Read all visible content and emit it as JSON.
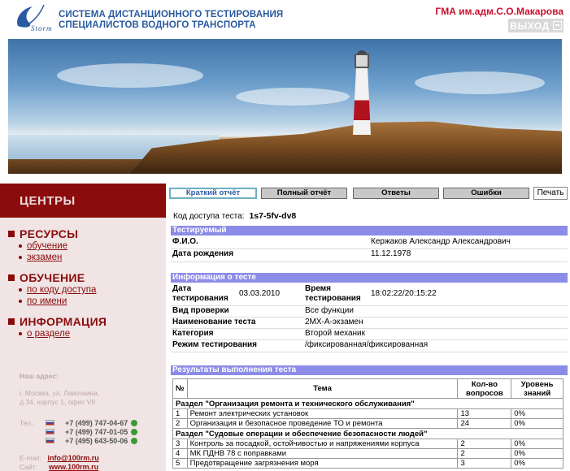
{
  "header": {
    "logo_text": "Storm",
    "title_line1": "СИСТЕМА ДИСТАНЦИОННОГО ТЕСТИРОВАНИЯ",
    "title_line2": "СПЕЦИАЛИСТОВ ВОДНОГО ТРАНСПОРТА",
    "org_name": "ГМА им.адм.С.О.Макарова",
    "logout_label": "ВЫХОД"
  },
  "sidebar": {
    "heading": "ЦЕНТРЫ",
    "sections": [
      {
        "title": "РЕСУРСЫ",
        "links": [
          "обучение",
          "экзамен"
        ]
      },
      {
        "title": "ОБУЧЕНИЕ",
        "links": [
          "по коду доступа",
          "по имени"
        ]
      },
      {
        "title": "ИНФОРМАЦИЯ",
        "links": [
          "о разделе"
        ]
      }
    ],
    "address_label": "Наш адрес:",
    "address_line1": "г. Москва, ул. Лавочкина,",
    "address_line2": "д.34, корпус 1, офис VII",
    "phone_label": "Тел.:",
    "phones": [
      "+7 (499) 747-04-67",
      "+7 (499) 747-01-05",
      "+7 (495) 643-50-06"
    ],
    "email_label": "E-mail:",
    "email": "info@100rm.ru",
    "site_label": "Сайт:",
    "site": "www.100rm.ru"
  },
  "tabs": {
    "short_report": "Краткий отчёт",
    "full_report": "Полный отчёт",
    "answers": "Ответы",
    "errors": "Ошибки",
    "print": "Печать"
  },
  "access": {
    "label": "Код доступа теста:",
    "code": "1s7-5fv-dv8"
  },
  "tested": {
    "heading": "Тестируемый",
    "fio_label": "Ф.И.О.",
    "fio": "Кержаков Александр Александрович",
    "dob_label": "Дата рождения",
    "dob": "11.12.1978"
  },
  "test_info": {
    "heading": "Информация о тесте",
    "date_label": "Дата тестирования",
    "date": "03.03.2010",
    "time_label": "Время тестирования",
    "time": "18:02:22/20:15:22",
    "check_label": "Вид проверки",
    "check": "Все функции",
    "name_label": "Наименование теста",
    "name": "2МХ-А-экзамен",
    "cat_label": "Категория",
    "cat": "Второй механик",
    "mode_label": "Режим тестирования",
    "mode": "/фиксированная/фиксированная"
  },
  "results": {
    "heading": "Результаты выполнения теста",
    "col_num": "№",
    "col_topic": "Тема",
    "col_count": "Кол-во вопросов",
    "col_level": "Уровень знаний",
    "section1": "Раздел \"Организация ремонта и технического обслуживания\"",
    "rows1": [
      {
        "n": "1",
        "topic": "Ремонт электрических установок",
        "count": "13",
        "level": "0%"
      },
      {
        "n": "2",
        "topic": "Организация и безопасное проведение ТО и ремонта",
        "count": "24",
        "level": "0%"
      }
    ],
    "section2": "Раздел \"Судовые операции и обеспечение безопасности людей\"",
    "rows2": [
      {
        "n": "3",
        "topic": "Контроль за посадкой, остойчивостью и напряжениями корпуса",
        "count": "2",
        "level": "0%"
      },
      {
        "n": "4",
        "topic": "МК ПДНВ 78 с поправками",
        "count": "2",
        "level": "0%"
      },
      {
        "n": "5",
        "topic": "Предотвращение загрязнения моря",
        "count": "3",
        "level": "0%"
      }
    ]
  }
}
